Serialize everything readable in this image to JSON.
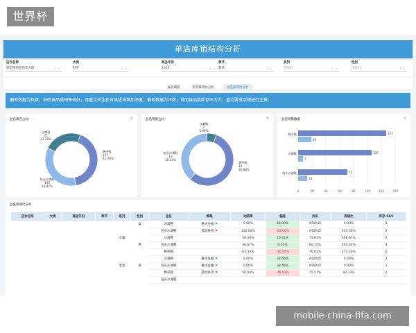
{
  "brand": "世界杯",
  "footer_url": "mobile-china-fifa.com",
  "header": {
    "title": "单店库销结构分析"
  },
  "filters": [
    {
      "label": "店仓名称",
      "value": "保定南市区百货大楼",
      "placeholder": false
    },
    {
      "label": "大类",
      "value": "鞋子",
      "placeholder": false
    },
    {
      "label": "商品年份",
      "value": "2016",
      "placeholder": false
    },
    {
      "label": "季节",
      "value": "夏季",
      "placeholder": false
    },
    {
      "label": "系列",
      "value": "无限制",
      "placeholder": true
    },
    {
      "label": "性别",
      "value": "无限制",
      "placeholder": true
    }
  ],
  "tabs": [
    {
      "label": "报表摘要",
      "active": false
    },
    {
      "label": "系列库销比分析",
      "active": false
    },
    {
      "label": "品名库销比分析",
      "active": true
    }
  ],
  "notice": "偏差数据为负数，说明该品类销售较好，请重点关注补货或适当增加深度；偏差数据为正数，说明该品类库存压力大，重点要求店铺进行主推；",
  "colors": {
    "header": "#3f9bd8",
    "ring_dark": "#6e85c8",
    "ring_light": "#8fb8ea",
    "ring_teal": "#3f7f95",
    "pos": "#d9f4dc",
    "neg": "#fbdada"
  },
  "charts": {
    "stock": {
      "title": "品名库存占比",
      "icon": "⇅",
      "chart_data": {
        "type": "pie",
        "slices": [
          {
            "name": "棉子鞋",
            "count": "127",
            "pct": "41.78%",
            "value": 127
          },
          {
            "name": "包头沙滩鞋",
            "count": "106",
            "pct": "34.87%",
            "value": 106
          },
          {
            "name": "沙滩鞋",
            "count": "71",
            "pct": "23.36%",
            "value": 71
          }
        ]
      }
    },
    "sales": {
      "title": "品名销量占比",
      "icon": "⇅",
      "chart_data": {
        "type": "pie",
        "slices": [
          {
            "name": "棉子鞋",
            "count": "19",
            "pct": "55.88%",
            "value": 19
          },
          {
            "name": "包头沙滩鞋",
            "count": "13",
            "pct": "38.24%",
            "value": 13
          },
          {
            "name": "沙滩鞋",
            "count": "2",
            "pct": "5.88%",
            "value": 2
          }
        ]
      }
    },
    "qty": {
      "title": "品名销量数据",
      "icon": "⇅",
      "chart_data": {
        "type": "bar",
        "orientation": "horizontal",
        "categories": [
          "棉子鞋",
          "沙滩鞋",
          "包头沙滩鞋"
        ],
        "series": [
          {
            "values": [
              127,
              106,
              71
            ]
          },
          {
            "values": [
              19,
              7,
              13
            ]
          }
        ],
        "xlim": [
          0,
          140
        ],
        "xticks": [
          "0",
          "20",
          "40",
          "60",
          "80",
          "100",
          "120",
          "140"
        ]
      }
    }
  },
  "table": {
    "title": "品名库销比分析",
    "columns": [
      "店仓名称",
      "大类",
      "商品年份",
      "季节",
      "系列",
      "性别",
      "品名",
      "策略",
      "动销率",
      "偏差",
      "折扣",
      "库销比",
      "库存-SKU"
    ],
    "group_labels": {
      "series_1": "小童",
      "gender_1": "女",
      "gender_2": "男",
      "series_2": "宝宝",
      "gender_3": "男"
    },
    "rows": [
      {
        "name": "沙滩鞋",
        "strategy": "重点主推",
        "flag": "g",
        "rate": "0.00%",
        "dev": "60.00%",
        "devc": "pos",
        "disc": "#DIV/0!",
        "ratio": "0.00%",
        "sku": "2"
      },
      {
        "name": "包头沙滩鞋",
        "strategy": "及时补货",
        "flag": "r",
        "rate": "100.00%",
        "dev": "-60.00%",
        "devc": "neg",
        "disc": "#DIV/0!",
        "ratio": "233.33%",
        "sku": "2"
      },
      {
        "name": "沙滩鞋",
        "strategy": "",
        "flag": "",
        "rate": "50.00%",
        "dev": "10.41%",
        "devc": "pos",
        "disc": "71.61%",
        "ratio": "466.67%",
        "sku": "2"
      },
      {
        "name": "包头沙滩鞋",
        "strategy": "",
        "flag": "",
        "rate": "46.67%",
        "dev": "6.53%",
        "devc": "pos",
        "disc": "80.72%",
        "ratio": "203.33%",
        "sku": "3"
      },
      {
        "name": "棉子鞋",
        "strategy": "",
        "flag": "",
        "rate": "63.33%",
        "dev": "-16.94%",
        "devc": "neg",
        "disc": "76.01%",
        "ratio": "173.33%",
        "sku": "6"
      },
      {
        "name": "沙滩鞋",
        "strategy": "重点主推",
        "flag": "g",
        "rate": "0.00%",
        "dev": "38.46%",
        "devc": "pos",
        "disc": "#DIV/0!",
        "ratio": "0.00%",
        "sku": "2"
      },
      {
        "name": "包头沙滩鞋",
        "strategy": "重点主推",
        "flag": "g",
        "rate": "0.00%",
        "dev": "38.46%",
        "devc": "pos",
        "disc": "#DIV/0!",
        "ratio": "0.00%",
        "sku": "1"
      },
      {
        "name": "棉子鞋",
        "strategy": "及时补货",
        "flag": "r",
        "rate": "50.00%",
        "dev": "-76.92%",
        "devc": "neg",
        "disc": "75.57%",
        "ratio": "93.33%",
        "sku": "2"
      },
      {
        "name": "包头沙滩鞋",
        "strategy": "",
        "flag": "",
        "rate": "",
        "dev": "",
        "devc": "",
        "disc": "",
        "ratio": "",
        "sku": ""
      }
    ]
  }
}
